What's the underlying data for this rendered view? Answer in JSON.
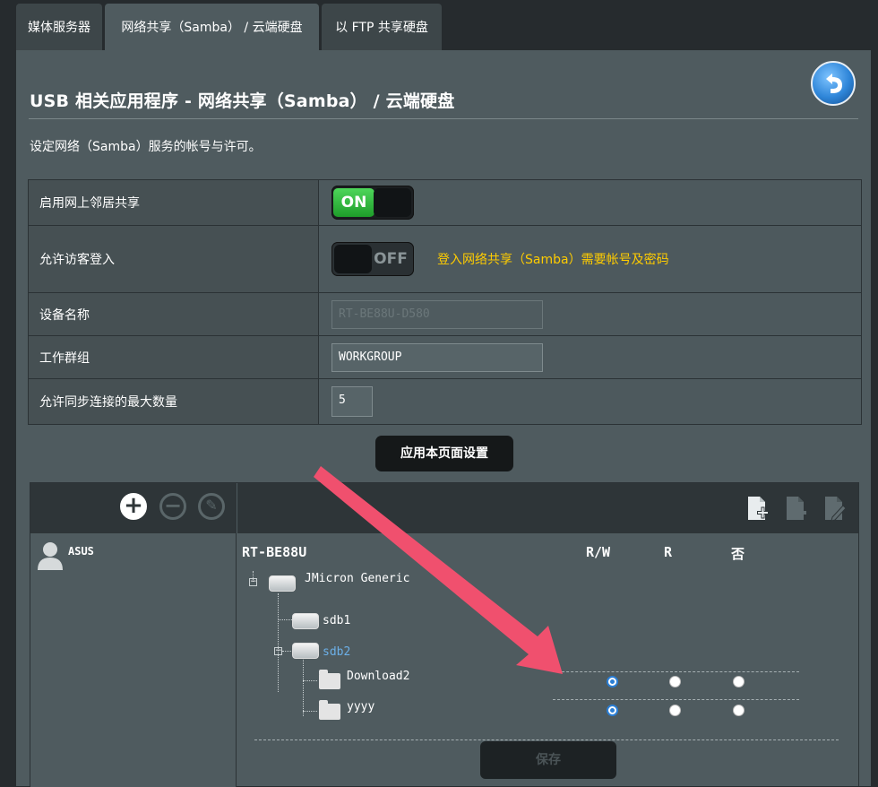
{
  "tabs": [
    {
      "label": "媒体服务器"
    },
    {
      "label": "网络共享（Samba） / 云端硬盘"
    },
    {
      "label": "以 FTP 共享硬盘"
    }
  ],
  "page": {
    "title": "USB 相关应用程序 - 网络共享（Samba） / 云端硬盘",
    "description": "设定网络（Samba）服务的帐号与许可。"
  },
  "settings": {
    "network_neighborhood": {
      "label": "启用网上邻居共享",
      "switch_text": "ON",
      "state": "on"
    },
    "guest_login": {
      "label": "允许访客登入",
      "switch_text": "OFF",
      "state": "off",
      "hint": "登入网络共享（Samba）需要帐号及密码"
    },
    "device_name": {
      "label": "设备名称",
      "value": "RT-BE88U-D580"
    },
    "workgroup": {
      "label": "工作群组",
      "value": "WORKGROUP"
    },
    "max_connections": {
      "label": "允许同步连接的最大数量",
      "value": "5"
    },
    "apply_label": "应用本页面设置"
  },
  "share": {
    "users": [
      {
        "name": "ASUS"
      }
    ],
    "tree_title": "RT-BE88U",
    "columns": [
      "R/W",
      "R",
      "否"
    ],
    "disk": "JMicron Generic",
    "partitions": [
      {
        "name": "sdb1"
      },
      {
        "name": "sdb2"
      }
    ],
    "folders": [
      {
        "name": "Download2",
        "permission": "R/W"
      },
      {
        "name": "yyyy",
        "permission": "R/W"
      }
    ],
    "save_label": "保存"
  },
  "colors": {
    "accent": "#ffcc00",
    "switch_on": "#2fb83a",
    "link": "#6cb0e8",
    "annotation_arrow": "#f0506e"
  }
}
